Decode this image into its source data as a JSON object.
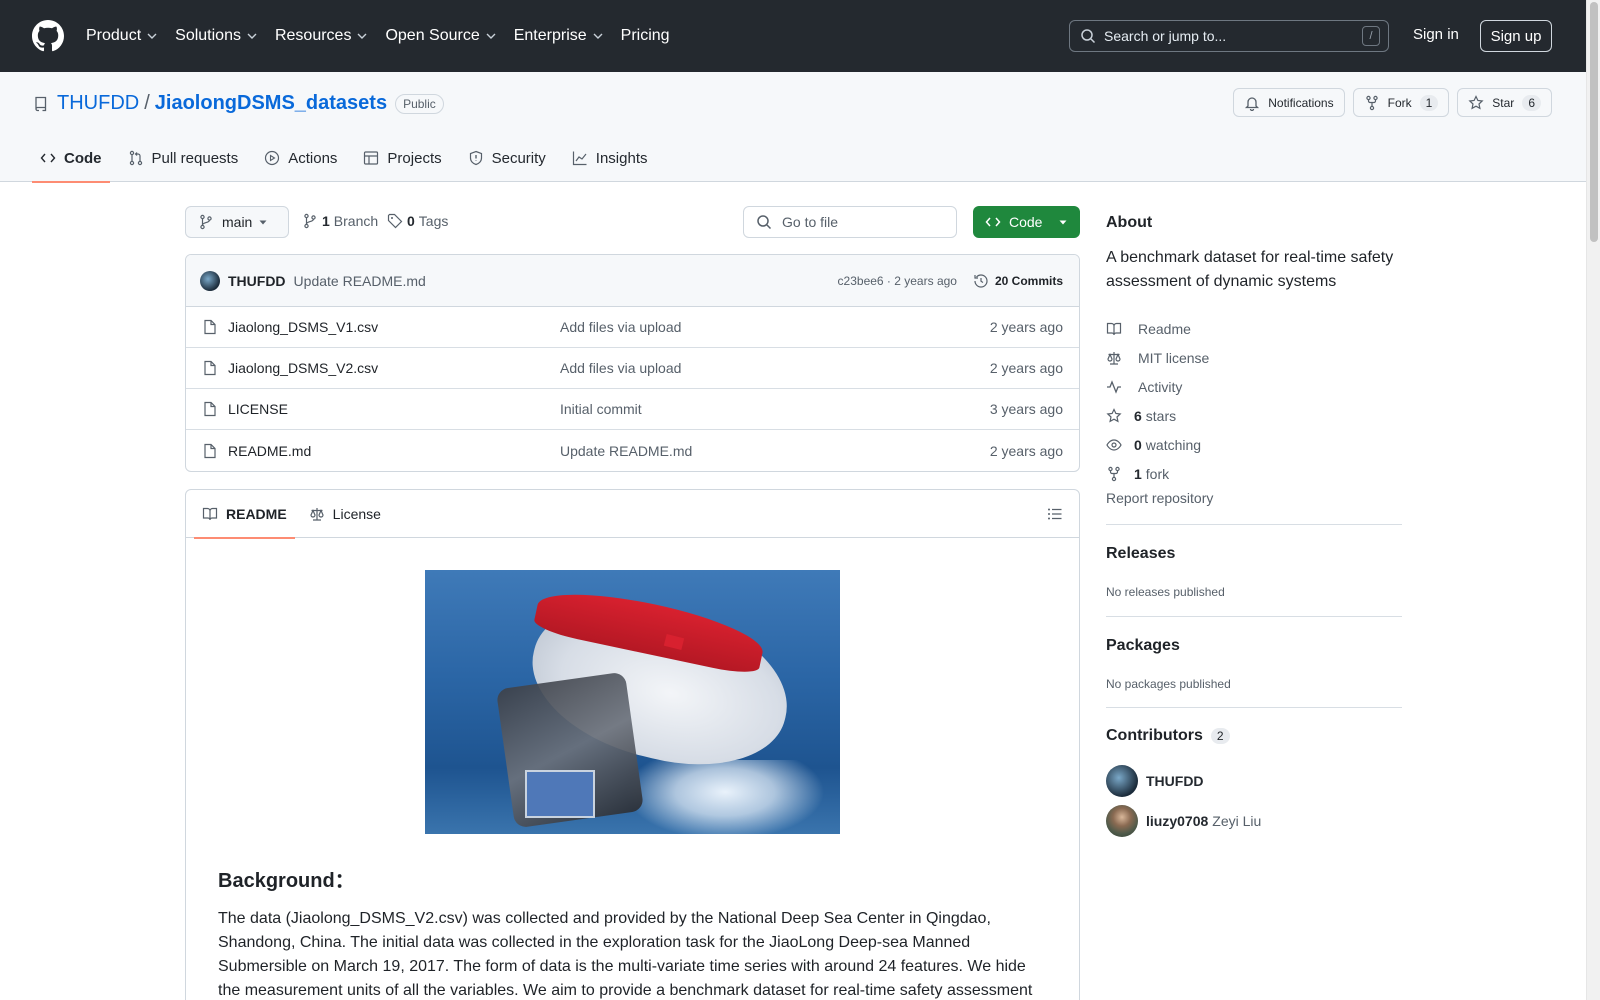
{
  "header": {
    "nav": [
      "Product",
      "Solutions",
      "Resources",
      "Open Source",
      "Enterprise",
      "Pricing"
    ],
    "search_placeholder": "Search or jump to...",
    "search_shortcut": "/",
    "sign_in": "Sign in",
    "sign_up": "Sign up"
  },
  "repo": {
    "owner": "THUFDD",
    "separator": "/",
    "name": "JiaolongDSMS_datasets",
    "visibility": "Public",
    "notifications": "Notifications",
    "fork_label": "Fork",
    "fork_count": "1",
    "star_label": "Star",
    "star_count": "6",
    "tabs": [
      "Code",
      "Pull requests",
      "Actions",
      "Projects",
      "Security",
      "Insights"
    ]
  },
  "toolbar": {
    "branch": "main",
    "branch_count": "1",
    "branch_label": "Branch",
    "tag_count": "0",
    "tag_label": "Tags",
    "goto_placeholder": "Go to file",
    "code_button": "Code"
  },
  "commit": {
    "author": "THUFDD",
    "message": "Update README.md",
    "meta": "c23bee6 · 2 years ago",
    "commits": "20 Commits"
  },
  "files": [
    {
      "name": "Jiaolong_DSMS_V1.csv",
      "commit": "Add files via upload",
      "age": "2 years ago"
    },
    {
      "name": "Jiaolong_DSMS_V2.csv",
      "commit": "Add files via upload",
      "age": "2 years ago"
    },
    {
      "name": "LICENSE",
      "commit": "Initial commit",
      "age": "3 years ago"
    },
    {
      "name": "README.md",
      "commit": "Update README.md",
      "age": "2 years ago"
    }
  ],
  "readme": {
    "tab_readme": "README",
    "tab_license": "License",
    "heading": "Background：",
    "paragraph": "The data (Jiaolong_DSMS_V2.csv) was collected and provided by the National Deep Sea Center in Qingdao, Shandong, China. The initial data was collected in the exploration task for the JiaoLong Deep-sea Manned Submersible on March 19, 2017. The form of data is the multi-variate time series with around 24 features. We hide the measurement units of all the variables. We aim to provide a benchmark dataset for real-time safety assessment"
  },
  "about": {
    "title": "About",
    "description": "A benchmark dataset for real-time safety assessment of dynamic systems",
    "items": [
      {
        "icon": "book-icon",
        "count": "",
        "label": "Readme"
      },
      {
        "icon": "law-icon",
        "count": "",
        "label": "MIT license"
      },
      {
        "icon": "pulse-icon",
        "count": "",
        "label": "Activity"
      },
      {
        "icon": "star-icon",
        "count": "6",
        "label": "stars"
      },
      {
        "icon": "eye-icon",
        "count": "0",
        "label": "watching"
      },
      {
        "icon": "fork-icon",
        "count": "1",
        "label": "fork"
      }
    ],
    "report": "Report repository"
  },
  "releases": {
    "title": "Releases",
    "note": "No releases published"
  },
  "packages": {
    "title": "Packages",
    "note": "No packages published"
  },
  "contributors": {
    "title": "Contributors",
    "count": "2",
    "list": [
      {
        "login": "THUFDD",
        "name": ""
      },
      {
        "login": "liuzy0708",
        "name": "Zeyi Liu"
      }
    ]
  },
  "colors": {
    "accent": "#0969da",
    "green": "#1f883d",
    "tab_underline": "#fd8c73",
    "header_bg": "#24292f"
  }
}
